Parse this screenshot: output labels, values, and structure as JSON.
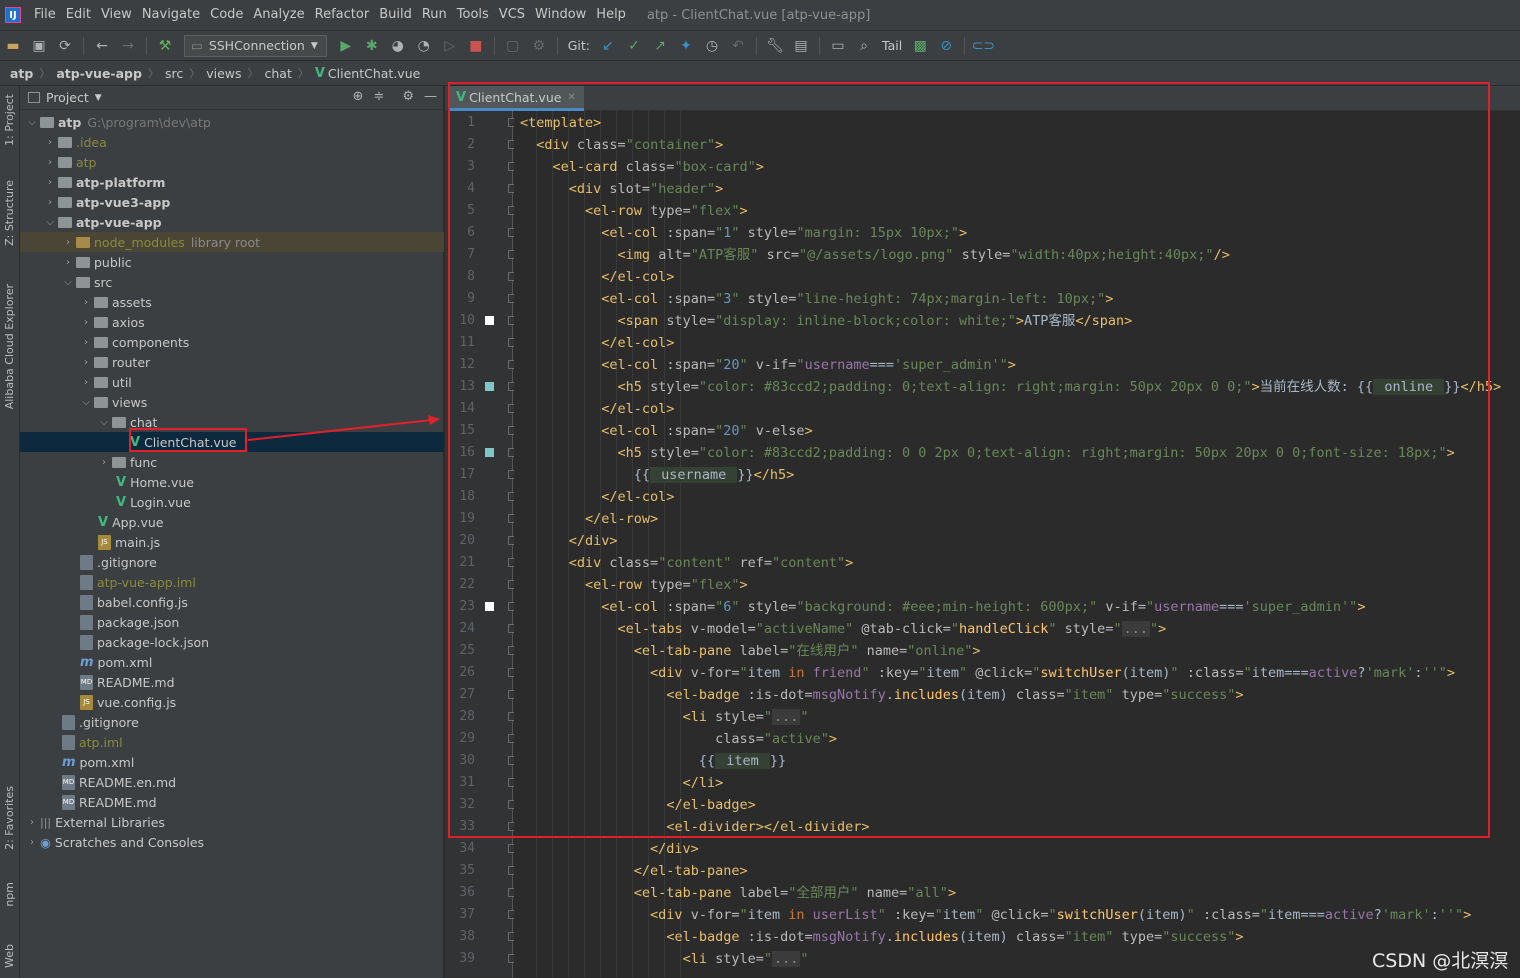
{
  "menu": {
    "items": [
      "File",
      "Edit",
      "View",
      "Navigate",
      "Code",
      "Analyze",
      "Refactor",
      "Build",
      "Run",
      "Tools",
      "VCS",
      "Window",
      "Help"
    ],
    "window_title": "atp - ClientChat.vue [atp-vue-app]"
  },
  "toolbar": {
    "run_config": "SSHConnection",
    "git_label": "Git:",
    "tail_label": "Tail"
  },
  "breadcrumb": [
    "atp",
    "atp-vue-app",
    "src",
    "views",
    "chat",
    "ClientChat.vue"
  ],
  "side_tabs": {
    "project": "1: Project",
    "structure": "Z: Structure",
    "cloud": "Alibaba Cloud Explorer",
    "favorites": "2: Favorites",
    "npm": "npm",
    "web": "Web"
  },
  "project_panel": {
    "title": "Project",
    "tree": [
      {
        "label": "atp",
        "extra": "G:\\program\\dev\\atp",
        "bold": true
      },
      {
        "label": ".idea"
      },
      {
        "label": "atp"
      },
      {
        "label": "atp-platform",
        "bold": true
      },
      {
        "label": "atp-vue3-app",
        "bold": true
      },
      {
        "label": "atp-vue-app",
        "bold": true
      },
      {
        "label": "node_modules",
        "extra": "library root"
      },
      {
        "label": "public"
      },
      {
        "label": "src"
      },
      {
        "label": "assets"
      },
      {
        "label": "axios"
      },
      {
        "label": "components"
      },
      {
        "label": "router"
      },
      {
        "label": "util"
      },
      {
        "label": "views"
      },
      {
        "label": "chat"
      },
      {
        "label": "ClientChat.vue"
      },
      {
        "label": "func"
      },
      {
        "label": "Home.vue"
      },
      {
        "label": "Login.vue"
      },
      {
        "label": "App.vue"
      },
      {
        "label": "main.js"
      },
      {
        "label": ".gitignore"
      },
      {
        "label": "atp-vue-app.iml"
      },
      {
        "label": "babel.config.js"
      },
      {
        "label": "package.json"
      },
      {
        "label": "package-lock.json"
      },
      {
        "label": "pom.xml"
      },
      {
        "label": "README.md"
      },
      {
        "label": "vue.config.js"
      },
      {
        "label": ".gitignore"
      },
      {
        "label": "atp.iml"
      },
      {
        "label": "pom.xml"
      },
      {
        "label": "README.en.md"
      },
      {
        "label": "README.md"
      },
      {
        "label": "External Libraries"
      },
      {
        "label": "Scratches and Consoles"
      }
    ]
  },
  "editor": {
    "tab": "ClientChat.vue",
    "line_numbers": [
      "1",
      "2",
      "3",
      "4",
      "5",
      "6",
      "7",
      "8",
      "9",
      "10",
      "11",
      "12",
      "13",
      "14",
      "15",
      "16",
      "17",
      "18",
      "19",
      "20",
      "21",
      "22",
      "23",
      "24",
      "25",
      "26",
      "27",
      "28",
      "29",
      "30",
      "31",
      "32",
      "33",
      "34",
      "35",
      "36",
      "37",
      "38",
      "39"
    ]
  },
  "watermark": "CSDN @北溟溟"
}
